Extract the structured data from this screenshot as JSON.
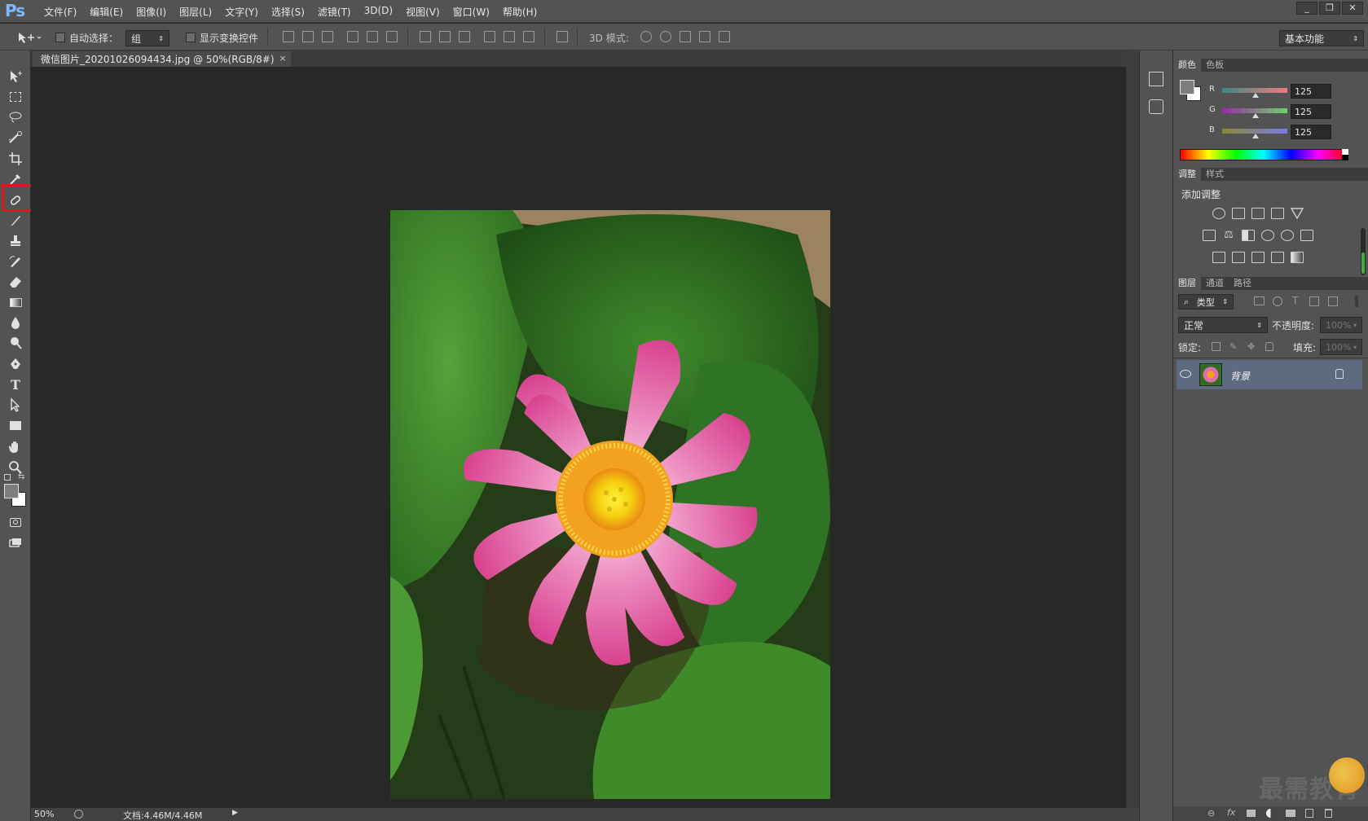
{
  "app": {
    "logo": "Ps"
  },
  "menu": [
    "文件(F)",
    "编辑(E)",
    "图像(I)",
    "图层(L)",
    "文字(Y)",
    "选择(S)",
    "滤镜(T)",
    "3D(D)",
    "视图(V)",
    "窗口(W)",
    "帮助(H)"
  ],
  "window_controls": [
    "_",
    "❐",
    "✕"
  ],
  "options": {
    "auto_select_label": "自动选择：",
    "auto_select_value": "组",
    "show_transform_label": "显示变换控件",
    "mode_3d_label": "3D 模式:",
    "workspace": "基本功能"
  },
  "document_tab": {
    "title": "微信图片_20201026094434.jpg @ 50%(RGB/8#)",
    "close": "×"
  },
  "color_panel": {
    "tabs": [
      "颜色",
      "色板"
    ],
    "r_label": "R",
    "g_label": "G",
    "b_label": "B",
    "r": "125",
    "g": "125",
    "b": "125"
  },
  "adjustments_panel": {
    "tabs": [
      "调整",
      "样式"
    ],
    "title": "添加调整"
  },
  "layers_panel": {
    "tabs": [
      "图层",
      "通道",
      "路径"
    ],
    "filter_kind": "类型",
    "blend_mode": "正常",
    "opacity_label": "不透明度:",
    "opacity_value": "100%",
    "lock_label": "锁定:",
    "fill_label": "填充:",
    "fill_value": "100%",
    "layer_name": "背景"
  },
  "status": {
    "zoom": "50%",
    "doc_size": "文档:4.46M/4.46M"
  },
  "watermark": "最需教育",
  "colors": {
    "highlight": "#e2141d",
    "ui_bg": "#535353",
    "canvas_bg": "#282828",
    "layer_selected": "#5e6a80"
  }
}
